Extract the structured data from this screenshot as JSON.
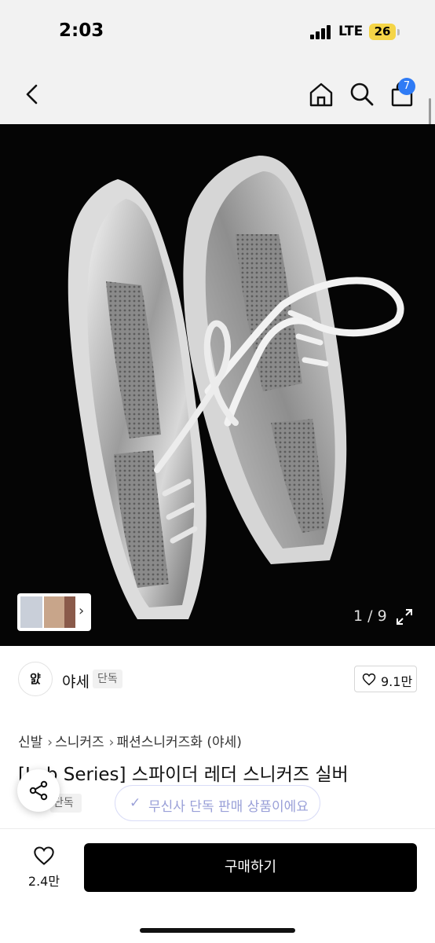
{
  "status_bar": {
    "time": "2:03",
    "network": "LTE",
    "battery": "26",
    "battery_color": "#f5d547"
  },
  "nav": {
    "back_icon": "chevron-left-icon",
    "home_icon": "home-icon",
    "search_icon": "search-icon",
    "cart_icon": "shopping-bag-icon",
    "cart_badge": "7",
    "badge_color": "#2f7bf5"
  },
  "gallery": {
    "counter": "1 / 9",
    "thumb_arrow": "›",
    "expand_icon": "expand-icon"
  },
  "brand": {
    "logo_text": "얈",
    "name": "야세",
    "tag": "단독",
    "likes": "9.1만"
  },
  "breadcrumb": {
    "items": [
      "신발",
      "스니커즈",
      "패션스니커즈화 (야세)"
    ],
    "separator": "›"
  },
  "product": {
    "title": "[Lab Series] 스파이더 레더 스니커즈 실버",
    "exclusive_tag": "단독",
    "exclusive_check": "✓",
    "exclusive_notice": "무신사 단독 판매 상품이에요"
  },
  "bottom_bar": {
    "wish_count": "2.4만",
    "buy_label": "구매하기"
  }
}
